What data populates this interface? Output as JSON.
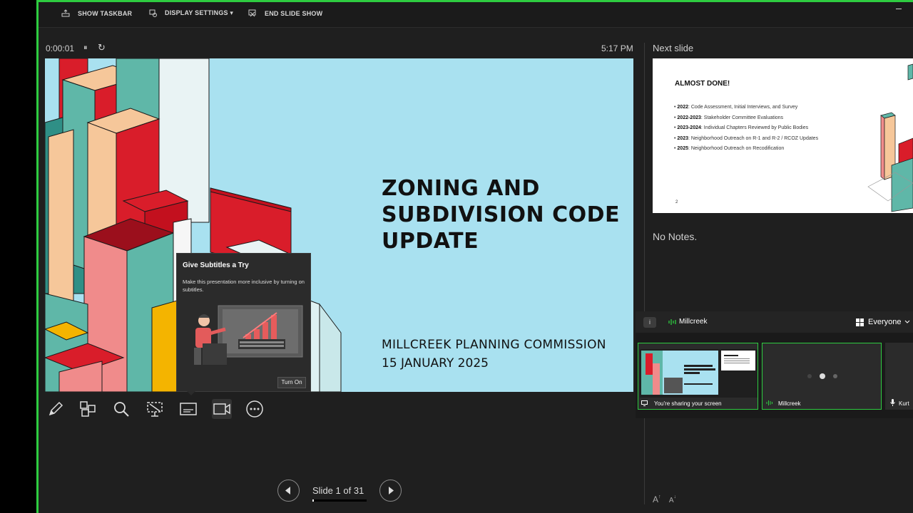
{
  "toolbar": {
    "show_taskbar": "SHOW TASKBAR",
    "display_settings": "DISPLAY SETTINGS ▾",
    "end_show": "END SLIDE SHOW"
  },
  "presenter": {
    "timer": "0:00:01",
    "pause_icon": "⏸",
    "restart_icon": "↻",
    "clock": "5:17 PM"
  },
  "slide": {
    "title_lines": [
      "ZONING AND",
      "SUBDIVISION CODE",
      "UPDATE"
    ],
    "subtitle": "MILLCREEK PLANNING COMMISSION",
    "date": "15 JANUARY 2025"
  },
  "subtitle_popup": {
    "title": "Give Subtitles a Try",
    "body": "Make this presentation more inclusive by turning on subtitles.",
    "button": "Turn On"
  },
  "navigation": {
    "counter": "Slide 1 of 31",
    "progress_fraction": 0.032
  },
  "next_slide": {
    "label": "Next slide",
    "title": "ALMOST DONE!",
    "items": [
      {
        "year": "2022",
        "text": ": Code Assessment, Initial Interviews, and Survey"
      },
      {
        "year": "2022-2023",
        "text": ": Stakeholder Committee Evaluations"
      },
      {
        "year": "2023-2024",
        "text": ": Individual Chapters Reviewed by Public Bodies"
      },
      {
        "year": "2023",
        "text": ": Neighborhood Outreach on R-1 and R-2 / RCOZ Updates"
      },
      {
        "year": "2025",
        "text": ": Neighborhood Outreach on Recodification"
      }
    ],
    "page_number": "2"
  },
  "notes": "No Notes.",
  "meeting": {
    "host": "Millcreek",
    "audience": "Everyone",
    "tiles": [
      {
        "label": "You're sharing your screen"
      },
      {
        "label": "Millcreek"
      },
      {
        "label": "Kurt"
      }
    ]
  },
  "colors": {
    "accent_green": "#2ecc40",
    "slide_bg": "#a9e1f0",
    "panel_bg": "#1f1f1f"
  }
}
